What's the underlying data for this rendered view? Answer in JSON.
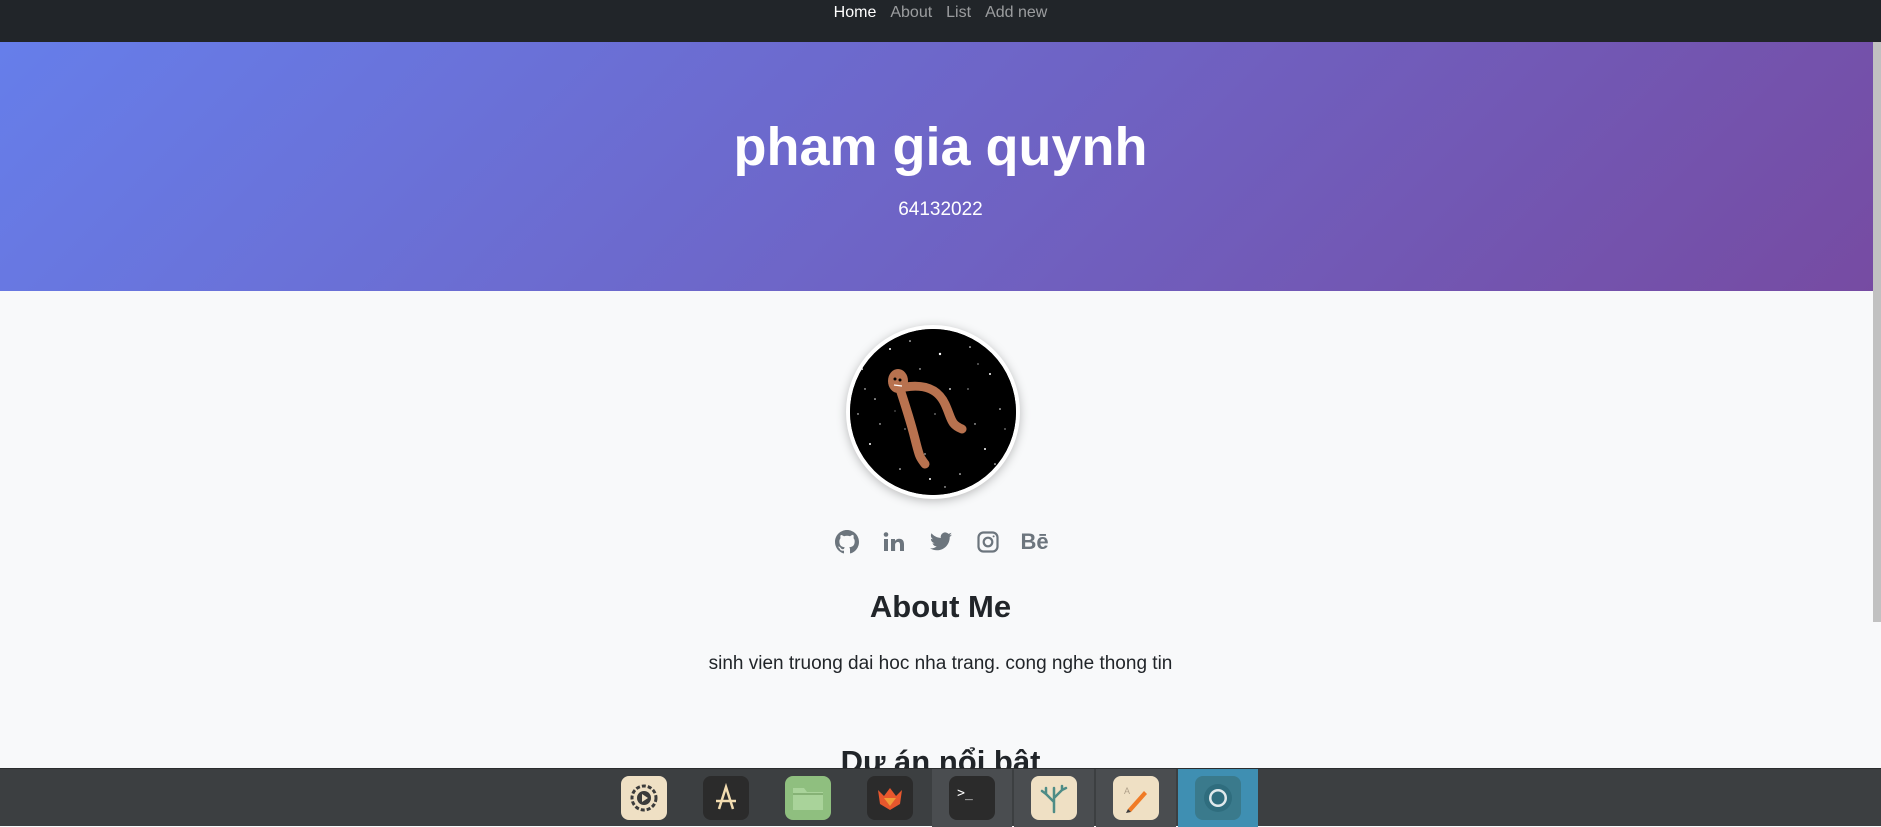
{
  "nav": {
    "links": [
      {
        "label": "Home",
        "active": true
      },
      {
        "label": "About"
      },
      {
        "label": "List"
      },
      {
        "label": "Add new"
      }
    ]
  },
  "hero": {
    "title": "pham gia quynh",
    "subtitle": "64132022",
    "gradient": [
      "#667eea",
      "#764ba2"
    ]
  },
  "profile": {
    "avatar_icon": "space-creature-avatar",
    "social": [
      "github-icon",
      "linkedin-icon",
      "twitter-icon",
      "instagram-icon",
      "behance-icon"
    ],
    "behance_label": "Bē"
  },
  "about": {
    "title": "About Me",
    "text": "sinh vien truong dai hoc nha trang. cong nghe thong tin"
  },
  "projects": {
    "title": "Dự án nổi bật"
  },
  "dock": {
    "items": [
      "settings-icon",
      "app-store-icon",
      "files-icon",
      "firefox-icon",
      "terminal-icon",
      "coral-app-icon",
      "text-editor-icon",
      "chrome-icon"
    ]
  }
}
